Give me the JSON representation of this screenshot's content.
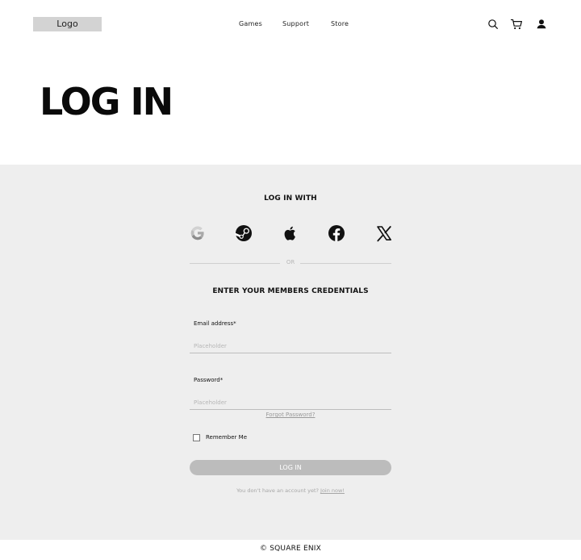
{
  "header": {
    "logo_text": "Logo",
    "nav": {
      "games": "Games",
      "support": "Support",
      "store": "Store"
    },
    "icons": [
      "search-icon",
      "cart-icon",
      "account-icon"
    ]
  },
  "page": {
    "title": "LOG IN"
  },
  "login": {
    "login_with_heading": "LOG IN WITH",
    "social_providers": [
      "google",
      "steam",
      "apple",
      "facebook",
      "x"
    ],
    "divider_text": "OR",
    "credentials_heading": "ENTER YOUR MEMBERS CREDENTIALS",
    "email": {
      "label": "Email address*",
      "placeholder": "Placeholder",
      "value": ""
    },
    "password": {
      "label": "Password*",
      "placeholder": "Placeholder",
      "value": ""
    },
    "forgot_password": "Forgot Password?",
    "remember_me": "Remember Me",
    "remember_checked": false,
    "submit_label": "LOG IN",
    "no_account_text": "You don't have an account yet?",
    "join_link": "Join now!"
  },
  "footer": {
    "copyright": "© SQUARE ENIX"
  },
  "colors": {
    "panel_background": "#eeeeee",
    "button_background": "#bcbcbc",
    "logo_background": "#d3d3d3",
    "text": "#111111",
    "muted_text": "#a6a6a6"
  }
}
